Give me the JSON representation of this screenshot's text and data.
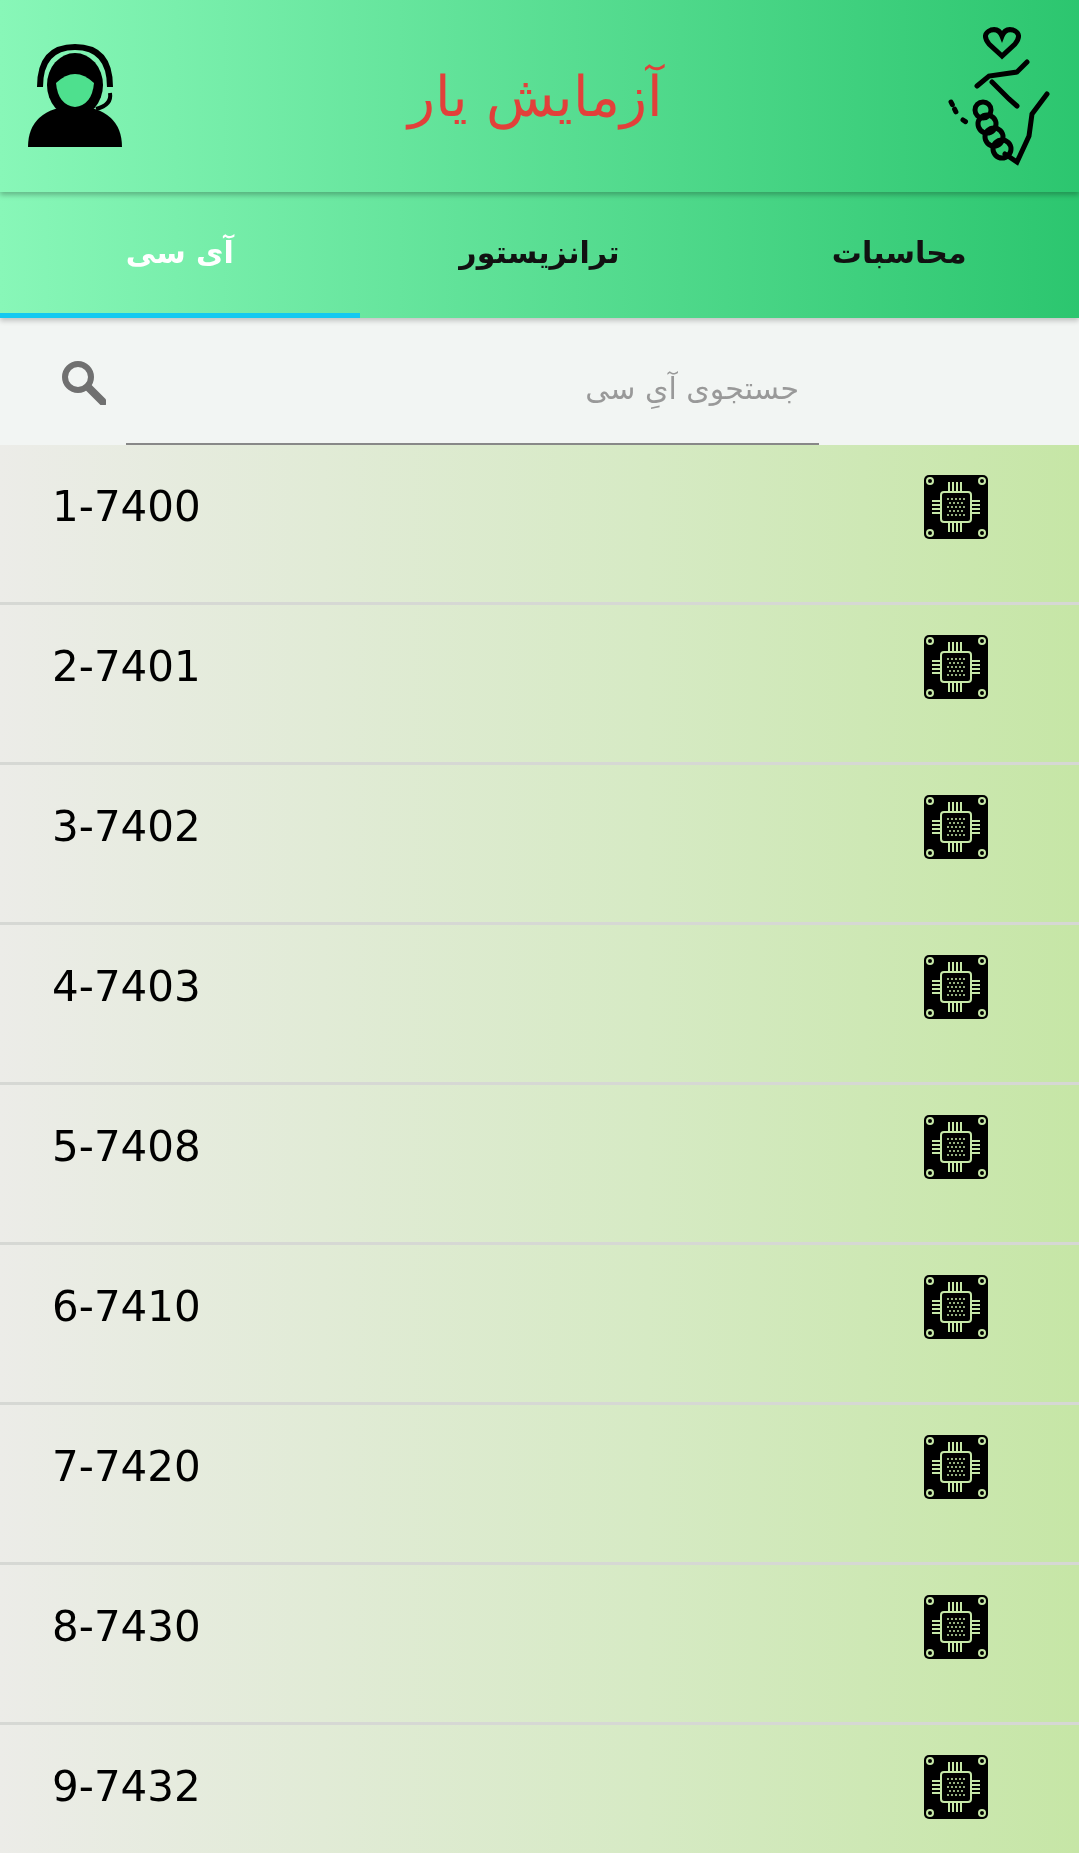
{
  "header": {
    "title": "آزمایش یار"
  },
  "tabs": [
    {
      "label": "محاسبات",
      "selected": false
    },
    {
      "label": "ترانزیستور",
      "selected": false
    },
    {
      "label": "آی سی",
      "selected": true
    }
  ],
  "search": {
    "placeholder": "جستجوی آیِ سی"
  },
  "items": [
    {
      "label": "1-7400"
    },
    {
      "label": "2-7401"
    },
    {
      "label": "3-7402"
    },
    {
      "label": "4-7403"
    },
    {
      "label": "5-7408"
    },
    {
      "label": "6-7410"
    },
    {
      "label": "7-7420"
    },
    {
      "label": "8-7430"
    },
    {
      "label": "9-7432"
    }
  ]
}
